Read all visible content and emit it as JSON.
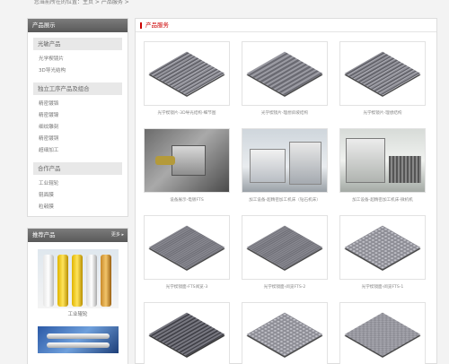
{
  "breadcrumb": "您当前所在的位置：主页 > 产品服务 >",
  "sidebar": {
    "display_title": "产品展示",
    "categories": [
      {
        "title": "光敏产品",
        "items": [
          "光学楔镜片",
          "3D导光结构"
        ]
      },
      {
        "title": "独立工序产品及组合",
        "items": [
          "精密镀铬",
          "精密镀镍",
          "细纹雕刻",
          "精密镀铜",
          "超细加工"
        ]
      },
      {
        "title": "合作产品",
        "items": [
          "工业辊轮",
          "辊面膜",
          "粒毂膜"
        ]
      }
    ],
    "recommend": {
      "title": "推荐产品",
      "more": "更多 ▸",
      "items": [
        "工业辊轮",
        ""
      ]
    }
  },
  "main": {
    "title": "产品服务",
    "products": [
      {
        "caption": "光学楔镜片-3D导光结构-细节图",
        "image": "ridge-plate"
      },
      {
        "caption": "光学楔镜片-理想斜坡结构",
        "image": "wave-plate"
      },
      {
        "caption": "光学楔镜片-理想结构",
        "image": "ridge-plate"
      },
      {
        "caption": "设备展示-电镀FTS",
        "image": "equipment-photo"
      },
      {
        "caption": "加工设备-超精密加工机床（钻石机床）",
        "image": "machine-photo"
      },
      {
        "caption": "加工设备-超精密加工机床-微机机",
        "image": "machine-photo"
      },
      {
        "caption": "光学楔镜面-FTS阅览-3",
        "image": "fine-plate"
      },
      {
        "caption": "光学楔镜面-阅览FTS-2",
        "image": "fine-plate"
      },
      {
        "caption": "光学楔镜面-阅览FTS-1",
        "image": "dots-plate"
      },
      {
        "caption": "",
        "image": "deep-plate"
      },
      {
        "caption": "",
        "image": "dots-plate"
      },
      {
        "caption": "",
        "image": "pyramid-plate"
      }
    ]
  },
  "colors": {
    "accent": "#cc0000",
    "panel_head": "#666666"
  }
}
